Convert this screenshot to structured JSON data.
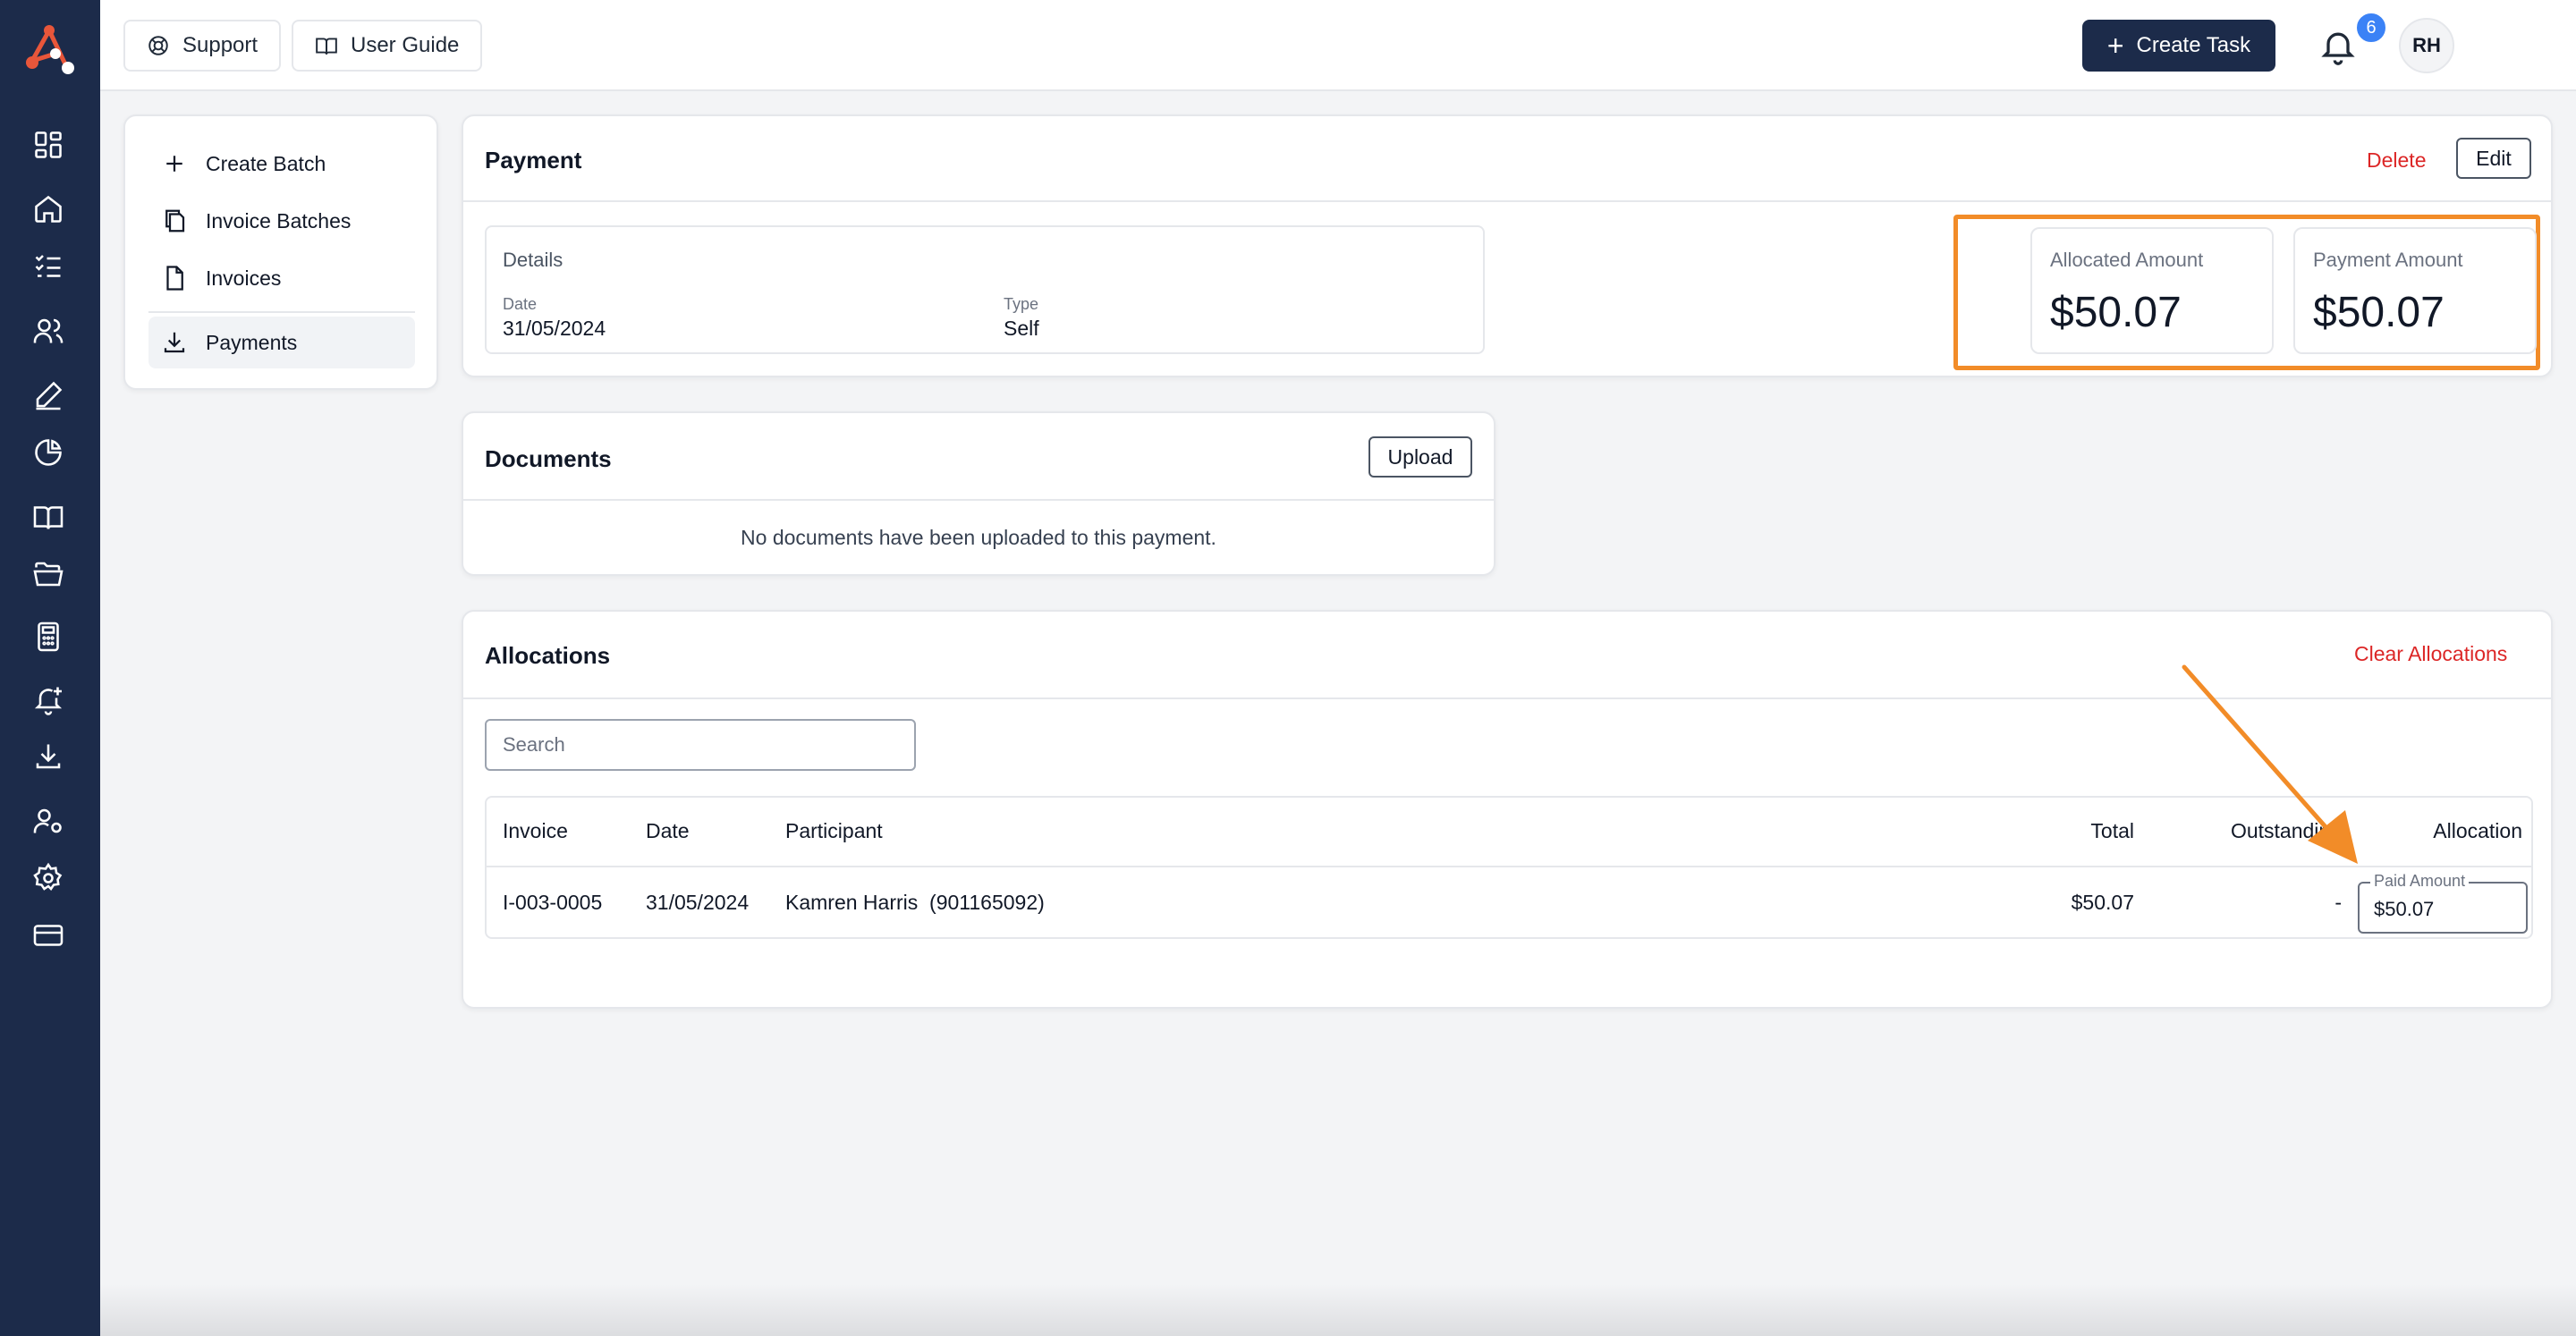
{
  "topbar": {
    "support_label": "Support",
    "user_guide_label": "User Guide",
    "create_task_label": "Create Task",
    "notification_count": "6",
    "avatar_initials": "RH"
  },
  "rail": {
    "icons": [
      "dashboard-icon",
      "home-icon",
      "tasks-icon",
      "users-icon",
      "signature-icon",
      "chart-pie-icon",
      "book-icon",
      "folder-icon",
      "calculator-icon",
      "bell-plus-icon",
      "download-icon",
      "user-settings-icon",
      "gear-icon",
      "credit-card-icon"
    ]
  },
  "sidemenu": {
    "items": [
      {
        "label": "Create Batch",
        "icon": "plus-icon"
      },
      {
        "label": "Invoice Batches",
        "icon": "copy-icon"
      },
      {
        "label": "Invoices",
        "icon": "file-icon"
      },
      {
        "label": "Payments",
        "icon": "download-icon",
        "active": true
      }
    ]
  },
  "payment": {
    "title": "Payment",
    "delete_label": "Delete",
    "edit_label": "Edit",
    "details_heading": "Details",
    "date_label": "Date",
    "date_value": "31/05/2024",
    "type_label": "Type",
    "type_value": "Self",
    "allocated_label": "Allocated Amount",
    "allocated_value": "$50.07",
    "payment_amount_label": "Payment Amount",
    "payment_amount_value": "$50.07",
    "highlight_color": "#f28c28"
  },
  "documents": {
    "title": "Documents",
    "upload_label": "Upload",
    "empty_text": "No documents have been uploaded to this payment."
  },
  "allocations": {
    "title": "Allocations",
    "clear_label": "Clear Allocations",
    "search_placeholder": "Search",
    "columns": [
      "Invoice",
      "Date",
      "Participant",
      "Total",
      "Outstanding",
      "Allocation"
    ],
    "rows": [
      {
        "invoice": "I-003-0005",
        "date": "31/05/2024",
        "participant": "Kamren Harris  (901165092)",
        "total": "$50.07",
        "outstanding": "-",
        "paid_label": "Paid Amount",
        "paid_value": "$50.07"
      }
    ]
  },
  "colors": {
    "rail": "#1c2b4a",
    "accent_orange": "#f28c28",
    "danger": "#dc2626",
    "badge": "#3b82f6"
  }
}
